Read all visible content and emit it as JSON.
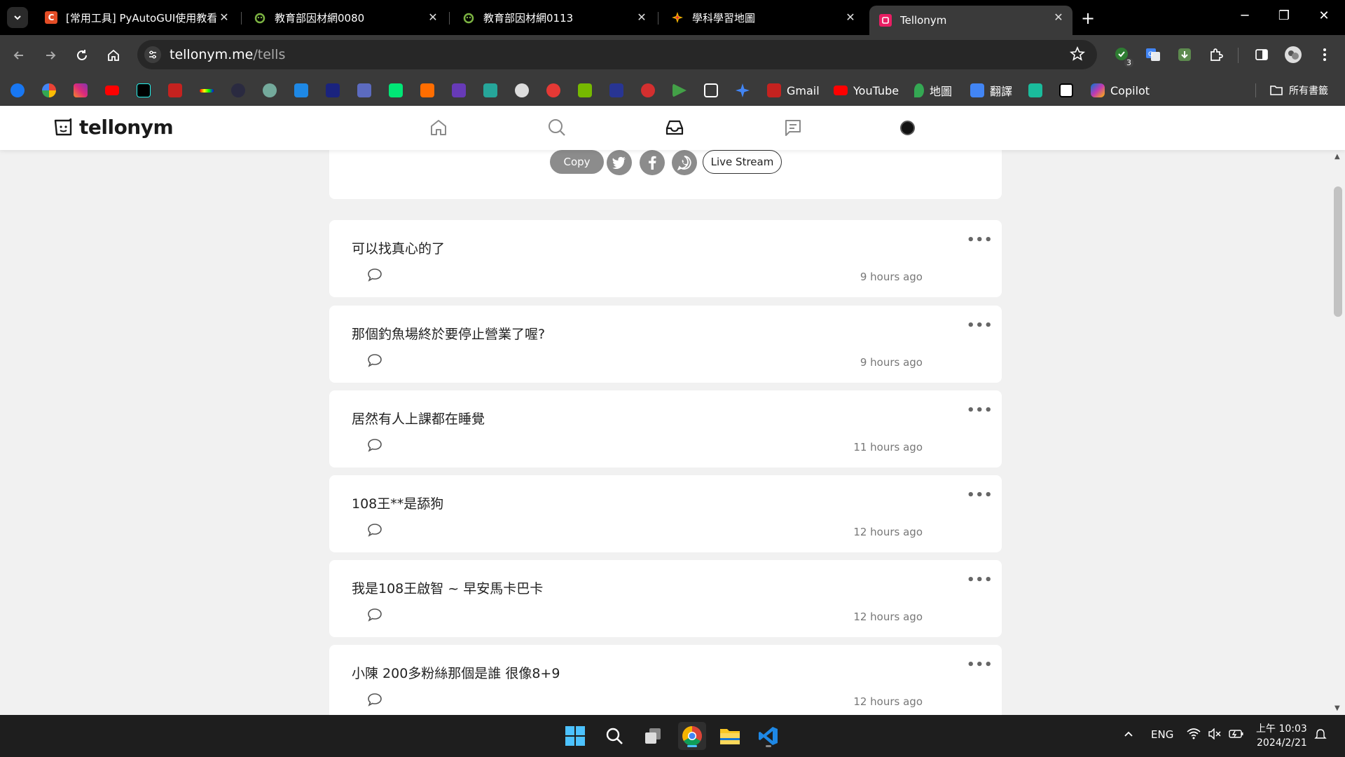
{
  "browser": {
    "tabs": [
      {
        "title": "[常用工具] PyAutoGUI使用教看",
        "favicon": "c-logo",
        "color": "#e44d26"
      },
      {
        "title": "教育部因材網0080",
        "favicon": "cloud-logo",
        "color": "#7cb342"
      },
      {
        "title": "教育部因材網0113",
        "favicon": "cloud-logo",
        "color": "#7cb342"
      },
      {
        "title": "學科學習地圖",
        "favicon": "star-logo",
        "color": "#f4b400"
      },
      {
        "title": "Tellonym",
        "favicon": "tellonym-logo",
        "color": "#e91e63"
      }
    ],
    "url_host": "tellonym.me",
    "url_path": "/tells",
    "extension_badge": "3",
    "bookmarks": [
      {
        "label": "Gmail",
        "icon": "gmail-icon"
      },
      {
        "label": "YouTube",
        "icon": "youtube-icon"
      },
      {
        "label": "地圖",
        "icon": "maps-icon"
      },
      {
        "label": "翻譯",
        "icon": "translate-icon"
      },
      {
        "label": "Copilot",
        "icon": "copilot-icon"
      }
    ],
    "all_bookmarks": "所有書籤"
  },
  "app": {
    "brand": "tellonym"
  },
  "share": {
    "copy": "Copy",
    "live": "Live Stream"
  },
  "tells": [
    {
      "text": "可以找真心的了",
      "time": "9 hours ago"
    },
    {
      "text": "那個釣魚場終於要停止營業了喔?",
      "time": "9 hours ago"
    },
    {
      "text": "居然有人上課都在睡覺",
      "time": "11 hours ago"
    },
    {
      "text": "108王**是舔狗",
      "time": "12 hours ago"
    },
    {
      "text": "我是108王啟智 ~ 早安馬卡巴卡",
      "time": "12 hours ago"
    },
    {
      "text": "小陳 200多粉絲那個是誰 很像8+9",
      "time": "12 hours ago"
    }
  ],
  "taskbar": {
    "lang": "ENG",
    "time": "上午 10:03",
    "date": "2024/2/21"
  }
}
